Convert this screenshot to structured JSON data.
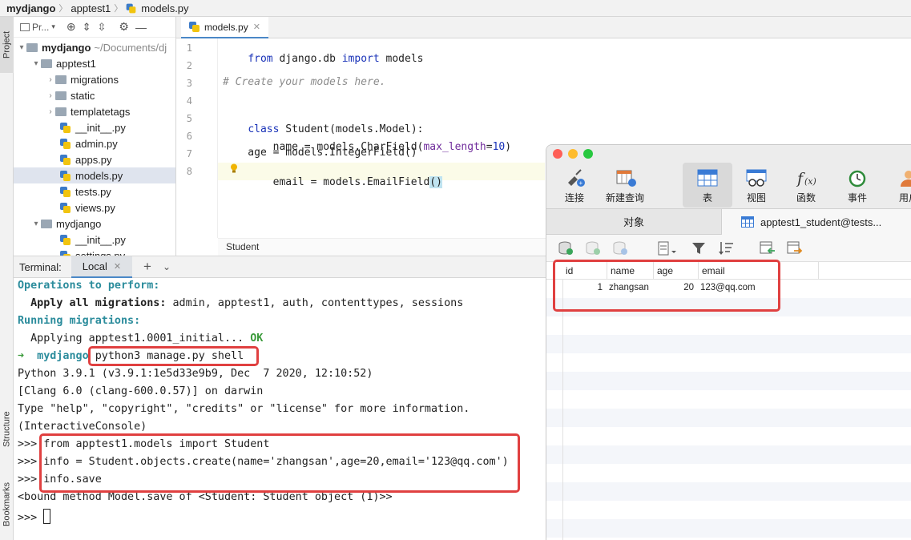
{
  "breadcrumb": {
    "project": "mydjango",
    "app": "apptest1",
    "file": "models.py"
  },
  "leftbar": {
    "project_tab": "Project",
    "structure_tab": "Structure",
    "bookmarks_tab": "Bookmarks"
  },
  "project_panel": {
    "title": "Pr...",
    "tree": [
      {
        "label": "mydjango",
        "path": "~/Documents/dj",
        "type": "root"
      },
      {
        "label": "apptest1",
        "type": "folder"
      },
      {
        "label": "migrations",
        "type": "folder"
      },
      {
        "label": "static",
        "type": "folder"
      },
      {
        "label": "templatetags",
        "type": "folder"
      },
      {
        "label": "__init__.py",
        "type": "file"
      },
      {
        "label": "admin.py",
        "type": "file"
      },
      {
        "label": "apps.py",
        "type": "file"
      },
      {
        "label": "models.py",
        "type": "file",
        "selected": true
      },
      {
        "label": "tests.py",
        "type": "file"
      },
      {
        "label": "views.py",
        "type": "file"
      },
      {
        "label": "mydjango",
        "type": "folder"
      },
      {
        "label": "__init__.py",
        "type": "file"
      },
      {
        "label": "settings.py",
        "type": "file"
      }
    ]
  },
  "editor": {
    "tab_label": "models.py",
    "line_numbers": [
      "1",
      "2",
      "3",
      "4",
      "5",
      "6",
      "7",
      "8"
    ],
    "code": {
      "l1_kw1": "from",
      "l1_mid": " django.db ",
      "l1_kw2": "import",
      "l1_end": " models",
      "l3": "# Create your models here.",
      "l5_kw": "class",
      "l5_rest": " Student(models.Model):",
      "l6_a": "    name = models.CharField(",
      "l6_arg": "max_length",
      "l6_eq": "=",
      "l6_num": "10",
      "l6_end": ")",
      "l7": "    age = models.IntegerField()",
      "l8_a": "    email = models.EmailField",
      "l8_paren": "()"
    },
    "status_breadcrumb": "Student"
  },
  "terminal": {
    "label": "Terminal:",
    "tab": "Local",
    "add": "+",
    "lines": {
      "ops_title": "Operations to perform:",
      "apply_bold": "  Apply all migrations:",
      "apply_rest": " admin, apptest1, auth, contenttypes, sessions",
      "running": "Running migrations:",
      "applying": "  Applying apptest1.0001_initial...",
      "ok": " OK",
      "prompt_arrow": "➜",
      "prompt_dir": "  mydjango",
      "shell_cmd": " python3 manage.py shell",
      "python_ver": "Python 3.9.1 (v3.9.1:1e5d33e9b9, Dec  7 2020, 12:10:52)",
      "clang": "[Clang 6.0 (clang-600.0.57)] on darwin",
      "type_help": "Type \"help\", \"copyright\", \"credits\" or \"license\" for more information.",
      "interactive": "(InteractiveConsole)",
      "cmd1": ">>> from apptest1.models import Student",
      "cmd2": ">>> info = Student.objects.create(name='zhangsan',age=20,email='123@qq.com')",
      "cmd3": ">>> info.save",
      "bound": "<bound method Model.save of <Student: Student object (1)>>",
      "last_prompt": ">>> "
    }
  },
  "navicat": {
    "toolbar": [
      {
        "label": "连接",
        "icon": "plug-icon"
      },
      {
        "label": "新建查询",
        "icon": "new-query-icon"
      },
      {
        "label": "表",
        "icon": "table-icon",
        "active": true
      },
      {
        "label": "视图",
        "icon": "view-icon"
      },
      {
        "label": "函数",
        "icon": "function-icon"
      },
      {
        "label": "事件",
        "icon": "clock-icon"
      },
      {
        "label": "用户",
        "icon": "user-icon"
      }
    ],
    "tab_objects": "对象",
    "tab_table": "apptest1_student@tests...",
    "columns": [
      "id",
      "name",
      "age",
      "email"
    ],
    "rows": [
      {
        "id": "1",
        "name": "zhangsan",
        "age": "20",
        "email": "123@qq.com"
      }
    ]
  }
}
